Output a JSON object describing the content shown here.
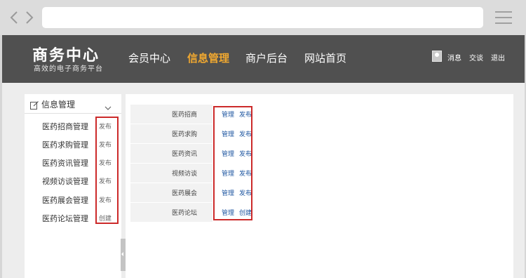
{
  "browser": {
    "nav_icon": "code-arrows-icon",
    "menu_icon": "hamburger-menu-icon",
    "url": ""
  },
  "header": {
    "title": "商务中心",
    "subtitle": "高效的电子商务平台",
    "nav": [
      {
        "label": "会员中心",
        "active": false
      },
      {
        "label": "信息管理",
        "active": true
      },
      {
        "label": "商户后台",
        "active": false
      },
      {
        "label": "网站首页",
        "active": false
      }
    ],
    "user": {
      "avatar_icon": "avatar-icon",
      "links": [
        "消息",
        "交谈",
        "退出"
      ]
    }
  },
  "sidebar": {
    "title": "信息管理",
    "title_icon": "edit-icon",
    "toggle_icon": "chevron-down-icon",
    "items": [
      {
        "label": "医药招商管理",
        "action": "发布"
      },
      {
        "label": "医药求购管理",
        "action": "发布"
      },
      {
        "label": "医药资讯管理",
        "action": "发布"
      },
      {
        "label": "视频访谈管理",
        "action": "发布"
      },
      {
        "label": "医药展会管理",
        "action": "发布"
      },
      {
        "label": "医药论坛管理",
        "action": "创建"
      }
    ]
  },
  "content": {
    "rows": [
      {
        "label": "医药招商",
        "manage": "管理",
        "action": "发布"
      },
      {
        "label": "医药求购",
        "manage": "管理",
        "action": "发布"
      },
      {
        "label": "医药资讯",
        "manage": "管理",
        "action": "发布"
      },
      {
        "label": "视频访谈",
        "manage": "管理",
        "action": "发布"
      },
      {
        "label": "医药展会",
        "manage": "管理",
        "action": "发布"
      },
      {
        "label": "医药论坛",
        "manage": "管理",
        "action": "创建"
      }
    ]
  },
  "colors": {
    "header_bg": "#505050",
    "active_nav": "#f0a830",
    "highlight_box": "#cc2a2a",
    "link": "#1e56a0"
  }
}
